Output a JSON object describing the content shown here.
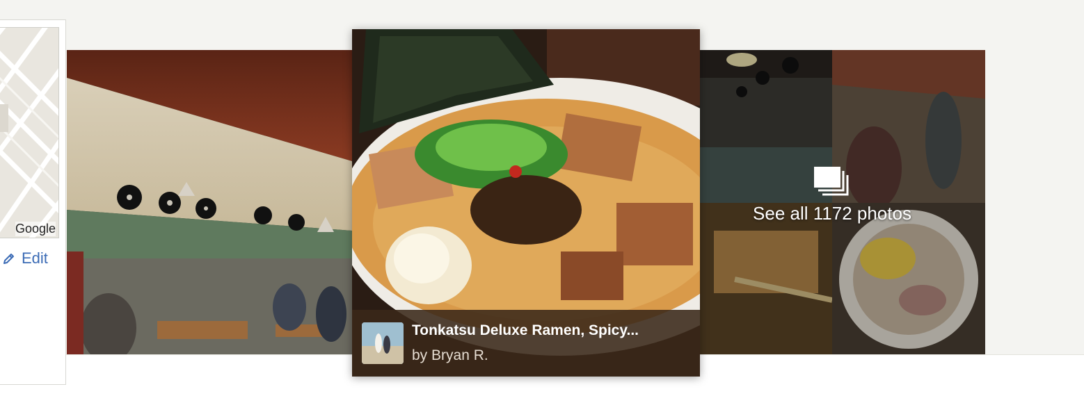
{
  "map": {
    "attribution": "Google",
    "edit_label": "Edit"
  },
  "featured_photo": {
    "title": "Tonkatsu Deluxe Ramen, Spicy...",
    "byline": "by Bryan R."
  },
  "gallery": {
    "see_all_label": "See all 1172 photos"
  },
  "icons": {
    "edit": "pencil-icon",
    "see_all": "photo-stack-icon"
  },
  "colors": {
    "link": "#3b6bb5",
    "caption_bg": "#3a2819",
    "page_band": "#f4f4f1"
  }
}
